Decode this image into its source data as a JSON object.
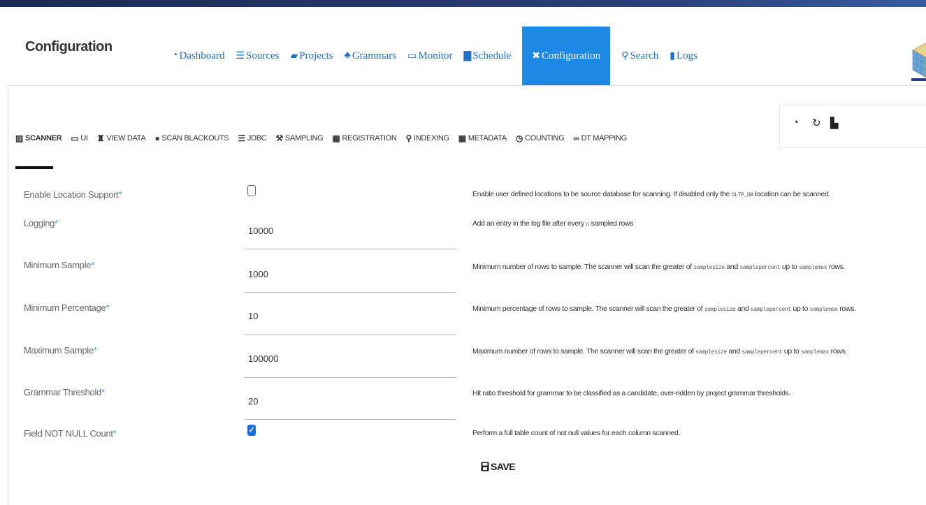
{
  "header": {
    "title": "Configuration",
    "nav": [
      {
        "icon": "pie-chart-icon",
        "glyph": "◔",
        "label": "Dashboard"
      },
      {
        "icon": "database-icon",
        "glyph": "☰",
        "label": "Sources"
      },
      {
        "icon": "folder-icon",
        "glyph": "▰",
        "label": "Projects"
      },
      {
        "icon": "sitemap-icon",
        "glyph": "♣",
        "label": "Grammars"
      },
      {
        "icon": "monitor-icon",
        "glyph": "▭",
        "label": "Monitor"
      },
      {
        "icon": "calendar-icon",
        "glyph": "▇",
        "label": "Schedule"
      },
      {
        "icon": "tools-icon",
        "glyph": "✖",
        "label": "Configuration"
      },
      {
        "icon": "search-icon",
        "glyph": "⚲",
        "label": "Search"
      },
      {
        "icon": "files-icon",
        "glyph": "▮",
        "label": "Logs"
      }
    ],
    "active_nav": "Configuration"
  },
  "subtabs": [
    {
      "icon": "barcode-icon",
      "glyph": "▥",
      "label": "SCANNER"
    },
    {
      "icon": "desktop-icon",
      "glyph": "▭",
      "label": "UI"
    },
    {
      "icon": "binoculars-icon",
      "glyph": "♜",
      "label": "VIEW DATA"
    },
    {
      "icon": "ban-icon",
      "glyph": "●",
      "label": "SCAN BLACKOUTS"
    },
    {
      "icon": "database-icon",
      "glyph": "☰",
      "label": "JDBC"
    },
    {
      "icon": "wrench-icon",
      "glyph": "⚒",
      "label": "SAMPLING"
    },
    {
      "icon": "table-icon",
      "glyph": "▦",
      "label": "REGISTRATION"
    },
    {
      "icon": "search-icon",
      "glyph": "⚲",
      "label": "INDEXING"
    },
    {
      "icon": "grid-icon",
      "glyph": "▦",
      "label": "METADATA"
    },
    {
      "icon": "timer-icon",
      "glyph": "◷",
      "label": "COUNTING"
    },
    {
      "icon": "link-icon",
      "glyph": "∞",
      "label": "DT MAPPING"
    }
  ],
  "active_subtab": "SCANNER",
  "tools": [
    {
      "icon": "pie-chart-icon",
      "glyph": "◔"
    },
    {
      "icon": "refresh-icon",
      "glyph": "↻"
    },
    {
      "icon": "bar-chart-icon",
      "glyph": "▙"
    }
  ],
  "form": {
    "required_mark": "*",
    "enable_location": {
      "label": "Enable Location Support",
      "checked": false,
      "desc_before": "Enable user defined locations to be source database for scanning. If disabled only the ",
      "desc_code": "OLTP_DB",
      "desc_after": " location can be scanned."
    },
    "logging": {
      "label": "Logging",
      "value": "10000",
      "desc_before": "Add an entry in the log file after every ",
      "desc_code": "n",
      "desc_after": " sampled rows"
    },
    "min_sample": {
      "label": "Minimum Sample",
      "value": "1000",
      "desc_before": "Minimum number of rows to sample. The scanner will scan the greater of ",
      "code1": "samplesize",
      "and": " and ",
      "code2": "samplepercent",
      "upto": " up to ",
      "code3": "samplemax",
      "rows": " rows."
    },
    "min_percentage": {
      "label": "Minimum Percentage",
      "value": "10",
      "desc_before": "Minimum percentage of rows to sample. The scanner will scan the greater of ",
      "code1": "samplesize",
      "and": " and ",
      "code2": "samplepercent",
      "upto": " up to ",
      "code3": "samplemax",
      "rows": " rows."
    },
    "max_sample": {
      "label": "Maximum Sample",
      "value": "100000",
      "desc_before": "Maximum number of rows to sample. The scanner will scan the greater of ",
      "code1": "samplesize",
      "and": " and ",
      "code2": "samplepercent",
      "upto": " up to ",
      "code3": "samplemax",
      "rows": " rows."
    },
    "grammar_threshold": {
      "label": "Grammar Threshold",
      "value": "20",
      "desc": "Hit ratio threshold for grammar to be classified as a candidate, over-ridden by project grammar thresholds."
    },
    "not_null_count": {
      "label": "Field NOT NULL Count",
      "checked": true,
      "desc": "Perform a full table count of not null values for each column scanned."
    },
    "save_label": "SAVE"
  }
}
